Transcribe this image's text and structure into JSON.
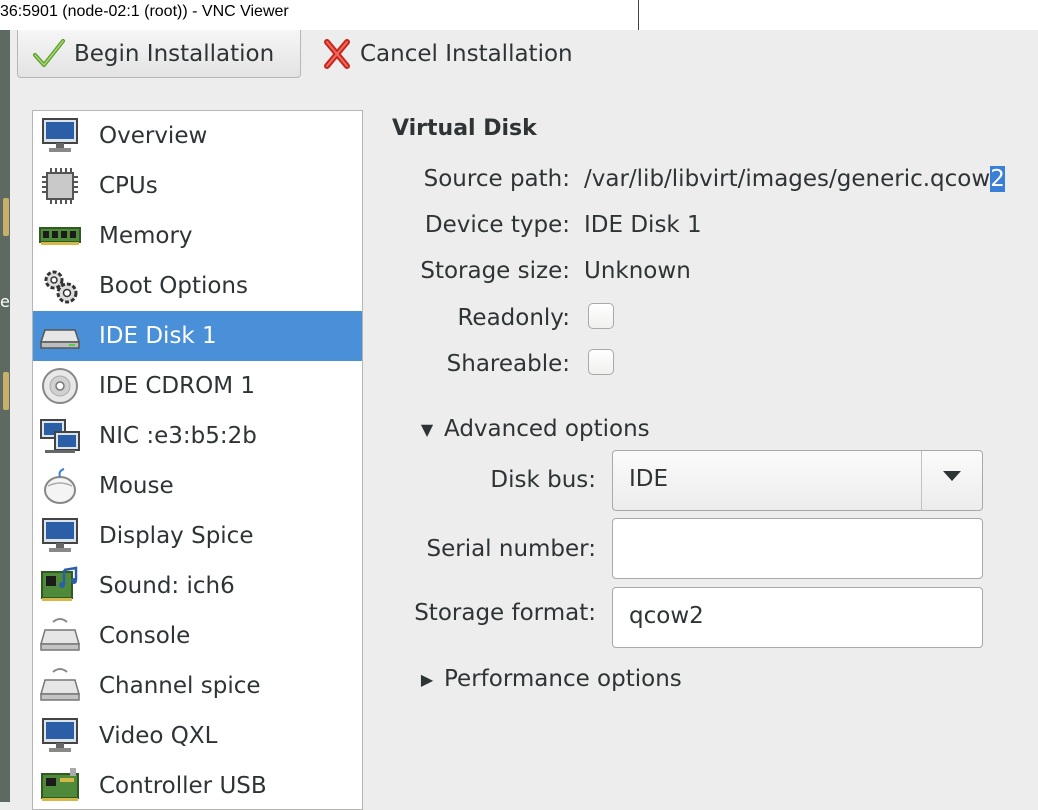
{
  "window": {
    "title": "36:5901 (node-02:1 (root)) - VNC Viewer"
  },
  "desktop": {
    "left_glyph": "e"
  },
  "toolbar": {
    "begin_label": "Begin Installation",
    "cancel_label": "Cancel Installation"
  },
  "sidebar": {
    "items": [
      {
        "label": "Overview",
        "icon": "monitor-icon"
      },
      {
        "label": "CPUs",
        "icon": "cpu-chip-icon"
      },
      {
        "label": "Memory",
        "icon": "memory-module-icon"
      },
      {
        "label": "Boot Options",
        "icon": "gears-icon"
      },
      {
        "label": "IDE Disk 1",
        "icon": "hard-disk-icon",
        "selected": true
      },
      {
        "label": "IDE CDROM 1",
        "icon": "cdrom-icon"
      },
      {
        "label": "NIC :e3:b5:2b",
        "icon": "network-card-icon"
      },
      {
        "label": "Mouse",
        "icon": "mouse-icon"
      },
      {
        "label": "Display Spice",
        "icon": "display-icon"
      },
      {
        "label": "Sound: ich6",
        "icon": "sound-card-icon"
      },
      {
        "label": "Console",
        "icon": "serial-port-icon"
      },
      {
        "label": "Channel spice",
        "icon": "serial-port-icon"
      },
      {
        "label": "Video QXL",
        "icon": "video-monitor-icon"
      },
      {
        "label": "Controller USB",
        "icon": "controller-card-icon"
      }
    ]
  },
  "details": {
    "section_title": "Virtual Disk",
    "source_path_label": "Source path:",
    "source_path_value_main": "/var/lib/libvirt/images/generic.qcow",
    "source_path_value_selected": "2",
    "device_type_label": "Device type:",
    "device_type_value": "IDE Disk 1",
    "storage_size_label": "Storage size:",
    "storage_size_value": "Unknown",
    "readonly_label": "Readonly:",
    "readonly_checked": false,
    "shareable_label": "Shareable:",
    "shareable_checked": false,
    "advanced_label": "Advanced options",
    "advanced_expanded": true,
    "disk_bus_label": "Disk bus:",
    "disk_bus_value": "IDE",
    "serial_number_label": "Serial number:",
    "serial_number_value": "",
    "storage_format_label": "Storage format:",
    "storage_format_value": "qcow2",
    "performance_label": "Performance options",
    "performance_expanded": false
  },
  "colors": {
    "selection": "#4a90d9",
    "text_highlight": "#3b7fd6",
    "window_bg": "#ededed"
  }
}
